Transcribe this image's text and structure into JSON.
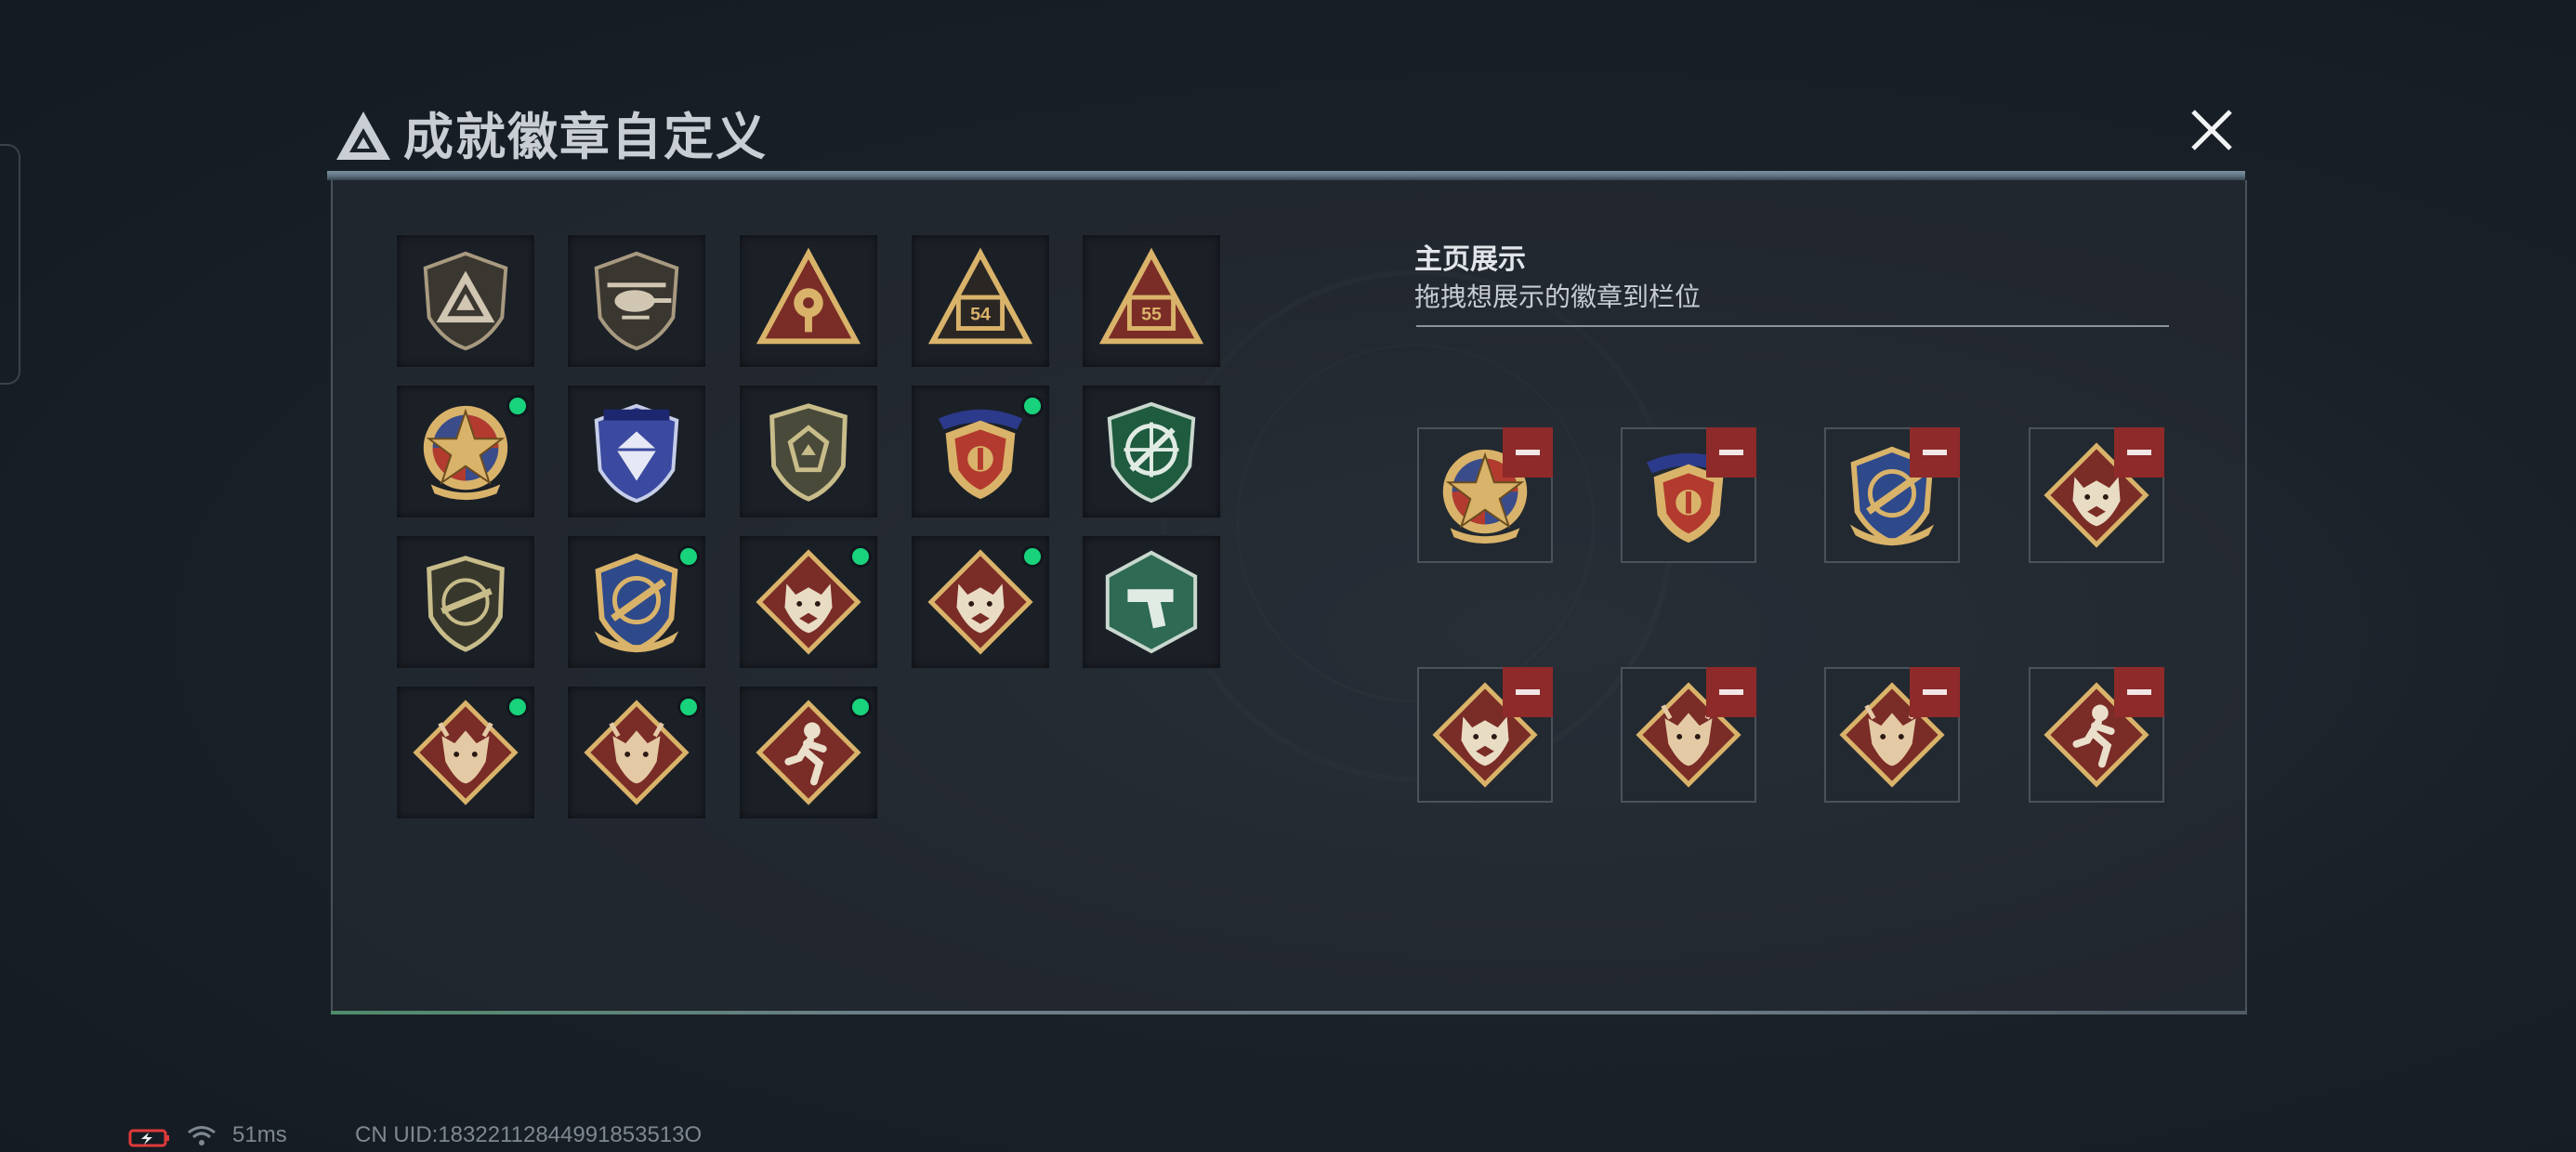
{
  "window": {
    "title": "成就徽章自定义"
  },
  "showcase": {
    "title": "主页展示",
    "subtitle": "拖拽想展示的徽章到栏位"
  },
  "colors": {
    "accent_green": "#19d27c",
    "remove_red": "#8e2a2a",
    "badge_gold": "#d9b36a",
    "badge_red": "#7a2c26"
  },
  "status_bar": {
    "ping": "51ms",
    "uid": "CN UID:18322112844991853513O"
  },
  "badges": [
    {
      "icon": "triangle-logo-shield-badge-icon",
      "equipped": false
    },
    {
      "icon": "helicopter-shield-badge-icon",
      "equipped": false
    },
    {
      "icon": "radar-triangle-badge-icon",
      "equipped": false
    },
    {
      "icon": "tower-54-triangle-badge-icon",
      "equipped": false
    },
    {
      "icon": "tower-55-triangle-badge-icon",
      "equipped": false
    },
    {
      "icon": "star-medal-badge-icon",
      "equipped": true
    },
    {
      "icon": "diamond-shield-badge-icon",
      "equipped": false
    },
    {
      "icon": "emblem-shield-badge-icon",
      "equipped": false
    },
    {
      "icon": "stars-ribbon-shield-badge-icon",
      "equipped": true
    },
    {
      "icon": "crosshair-green-badge-icon",
      "equipped": false
    },
    {
      "icon": "rifle-shield-badge-icon",
      "equipped": false
    },
    {
      "icon": "blue-gold-rifle-crest-badge-icon",
      "equipped": true
    },
    {
      "icon": "wolf-diamond-badge-icon",
      "equipped": true
    },
    {
      "icon": "wolf-diamond-badge-icon",
      "equipped": true
    },
    {
      "icon": "pistol-green-hex-badge-icon",
      "equipped": false
    },
    {
      "icon": "dragon-diamond-badge-icon",
      "equipped": true
    },
    {
      "icon": "dragon-diamond-badge-icon",
      "equipped": true
    },
    {
      "icon": "runner-diamond-badge-icon",
      "equipped": true
    }
  ],
  "slots": [
    {
      "icon": "star-medal-badge-icon"
    },
    {
      "icon": "stars-ribbon-shield-badge-icon"
    },
    {
      "icon": "blue-gold-rifle-crest-badge-icon"
    },
    {
      "icon": "wolf-diamond-badge-icon"
    },
    {
      "icon": "wolf-diamond-badge-icon"
    },
    {
      "icon": "dragon-diamond-badge-icon"
    },
    {
      "icon": "dragon-diamond-badge-icon"
    },
    {
      "icon": "runner-diamond-badge-icon"
    }
  ]
}
